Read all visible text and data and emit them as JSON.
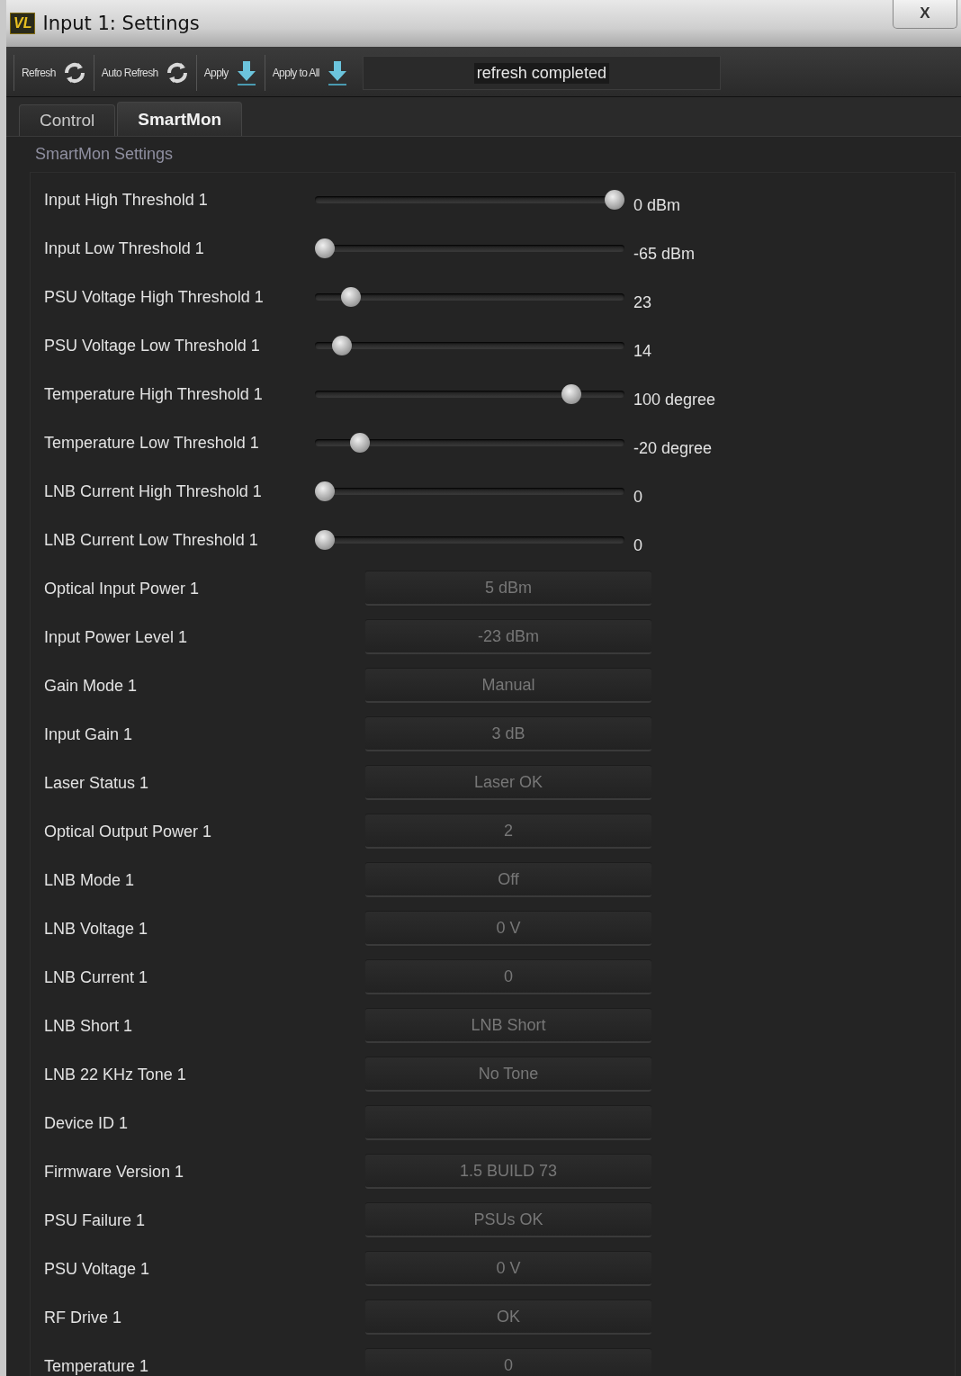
{
  "window": {
    "title": "Input 1: Settings",
    "logo": "VL",
    "close": "X"
  },
  "toolbar": {
    "buttons": [
      {
        "label": "Refresh",
        "kind": "refresh"
      },
      {
        "label": "Auto Refresh",
        "kind": "refresh"
      },
      {
        "label": "Apply",
        "kind": "apply"
      },
      {
        "label": "Apply to All",
        "kind": "apply"
      }
    ],
    "status": "refresh completed"
  },
  "tabs": [
    {
      "label": "Control",
      "selected": false
    },
    {
      "label": "SmartMon",
      "selected": true
    }
  ],
  "section": "SmartMon Settings",
  "rows": [
    {
      "kind": "slider",
      "label": "Input High Threshold 1",
      "level": 1.0,
      "reading": "0 dBm"
    },
    {
      "kind": "slider",
      "label": "Input Low Threshold 1",
      "level": 0,
      "reading": "-65 dBm"
    },
    {
      "kind": "slider",
      "label": "PSU Voltage High Threshold 1",
      "level": 0.09,
      "reading": "23"
    },
    {
      "kind": "slider",
      "label": "PSU Voltage Low Threshold 1",
      "level": 0.06,
      "reading": "14"
    },
    {
      "kind": "slider",
      "label": "Temperature High Threshold 1",
      "level": 0.85,
      "reading": "100 degree"
    },
    {
      "kind": "slider",
      "label": "Temperature Low Threshold 1",
      "level": 0.12,
      "reading": "-20 degree"
    },
    {
      "kind": "slider",
      "label": "LNB Current High Threshold 1",
      "level": 0,
      "reading": "0"
    },
    {
      "kind": "slider",
      "label": "LNB Current Low Threshold 1",
      "level": 0,
      "reading": "0"
    },
    {
      "kind": "readout",
      "label": "Optical Input Power 1",
      "value": "5 dBm"
    },
    {
      "kind": "readout",
      "label": "Input Power Level 1",
      "value": "-23 dBm"
    },
    {
      "kind": "readout",
      "label": "Gain Mode 1",
      "value": "Manual"
    },
    {
      "kind": "readout",
      "label": "Input Gain 1",
      "value": "3 dB"
    },
    {
      "kind": "readout",
      "label": "Laser Status 1",
      "value": "Laser OK"
    },
    {
      "kind": "readout",
      "label": "Optical Output Power 1",
      "value": "2"
    },
    {
      "kind": "readout",
      "label": "LNB Mode 1",
      "value": "Off"
    },
    {
      "kind": "readout",
      "label": "LNB Voltage 1",
      "value": "0 V"
    },
    {
      "kind": "readout",
      "label": "LNB Current 1",
      "value": "0"
    },
    {
      "kind": "readout",
      "label": "LNB Short 1",
      "value": "LNB Short"
    },
    {
      "kind": "readout",
      "label": "LNB 22 KHz Tone 1",
      "value": "No Tone"
    },
    {
      "kind": "readout",
      "label": "Device ID 1"
    },
    {
      "kind": "readout",
      "label": "Firmware Version 1",
      "value": "1.5 BUILD 73"
    },
    {
      "kind": "readout",
      "label": "PSU Failure 1",
      "value": "PSUs OK"
    },
    {
      "kind": "readout",
      "label": "PSU Voltage 1",
      "value": "0 V"
    },
    {
      "kind": "readout",
      "label": "RF Drive 1",
      "value": "OK"
    },
    {
      "kind": "readout",
      "label": "Temperature 1",
      "value": "0"
    }
  ]
}
